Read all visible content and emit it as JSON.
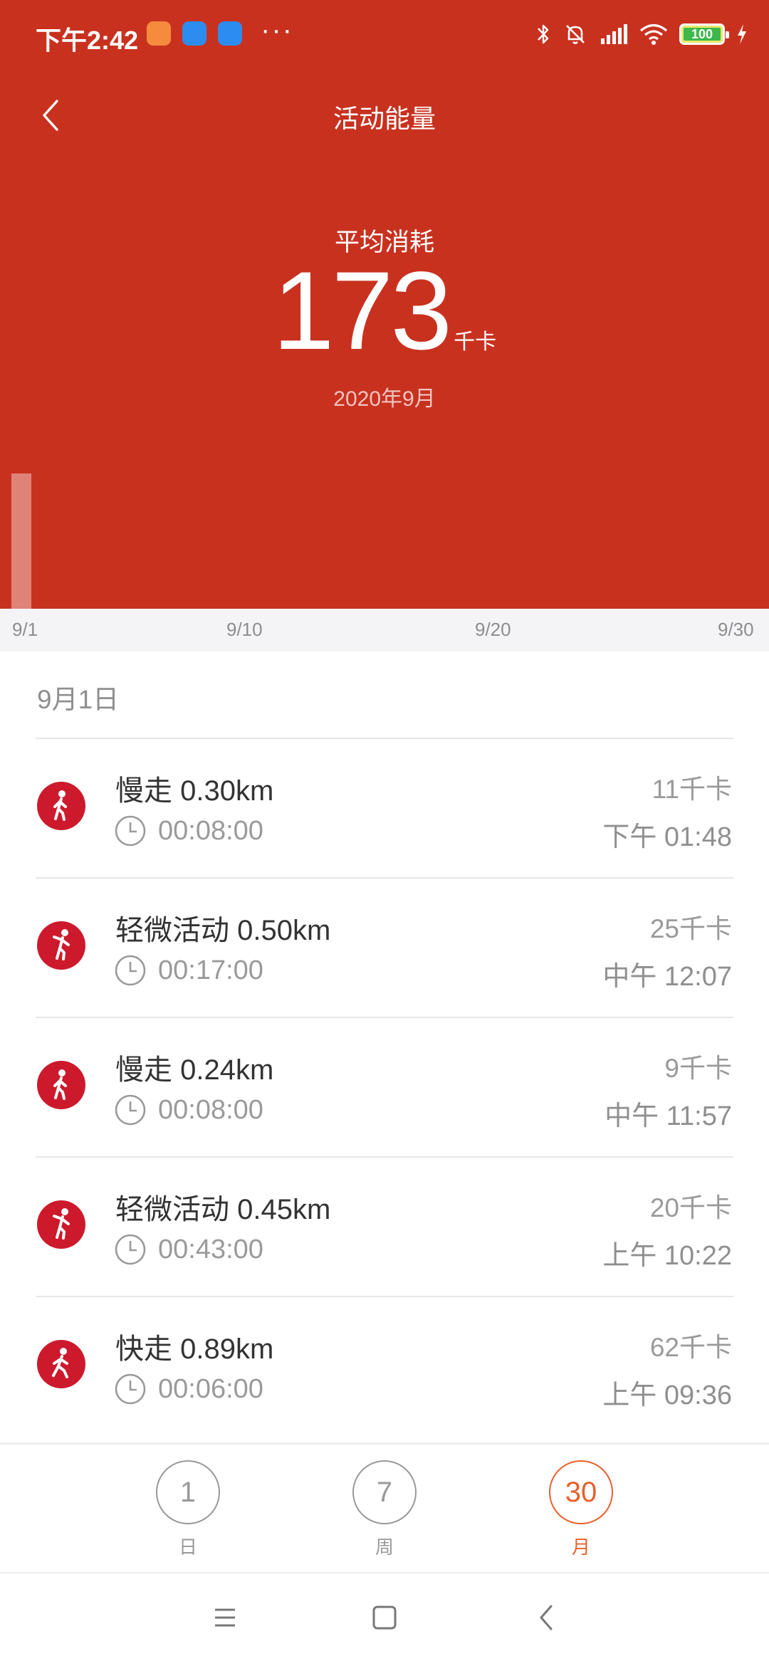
{
  "status_bar": {
    "time": "下午2:42",
    "battery": "100"
  },
  "header": {
    "title": "活动能量"
  },
  "summary": {
    "label": "平均消耗",
    "value": "173",
    "unit": "千卡",
    "period": "2020年9月"
  },
  "chart_data": {
    "type": "bar",
    "categories": [
      "9/1"
    ],
    "values": [
      173
    ],
    "x_ticks": [
      "9/1",
      "9/10",
      "9/20",
      "9/30"
    ],
    "x_range": [
      "9/1",
      "9/30"
    ]
  },
  "list": {
    "date_header": "9月1日",
    "activities": [
      {
        "title": "慢走 0.30km",
        "duration": "00:08:00",
        "kcal": "11千卡",
        "time": "下午 01:48",
        "icon": "walk-icon"
      },
      {
        "title": "轻微活动 0.50km",
        "duration": "00:17:00",
        "kcal": "25千卡",
        "time": "中午 12:07",
        "icon": "light-activity-icon"
      },
      {
        "title": "慢走 0.24km",
        "duration": "00:08:00",
        "kcal": "9千卡",
        "time": "中午 11:57",
        "icon": "walk-icon"
      },
      {
        "title": "轻微活动 0.45km",
        "duration": "00:43:00",
        "kcal": "20千卡",
        "time": "上午 10:22",
        "icon": "light-activity-icon"
      },
      {
        "title": "快走 0.89km",
        "duration": "00:06:00",
        "kcal": "62千卡",
        "time": "上午 09:36",
        "icon": "brisk-walk-icon"
      }
    ]
  },
  "period_selector": {
    "items": [
      {
        "number": "1",
        "label": "日",
        "active": false
      },
      {
        "number": "7",
        "label": "周",
        "active": false
      },
      {
        "number": "30",
        "label": "月",
        "active": true
      }
    ]
  },
  "colors": {
    "hero_red": "#c9311f",
    "icon_red": "#cc1a2c",
    "accent_orange": "#e8612c"
  }
}
